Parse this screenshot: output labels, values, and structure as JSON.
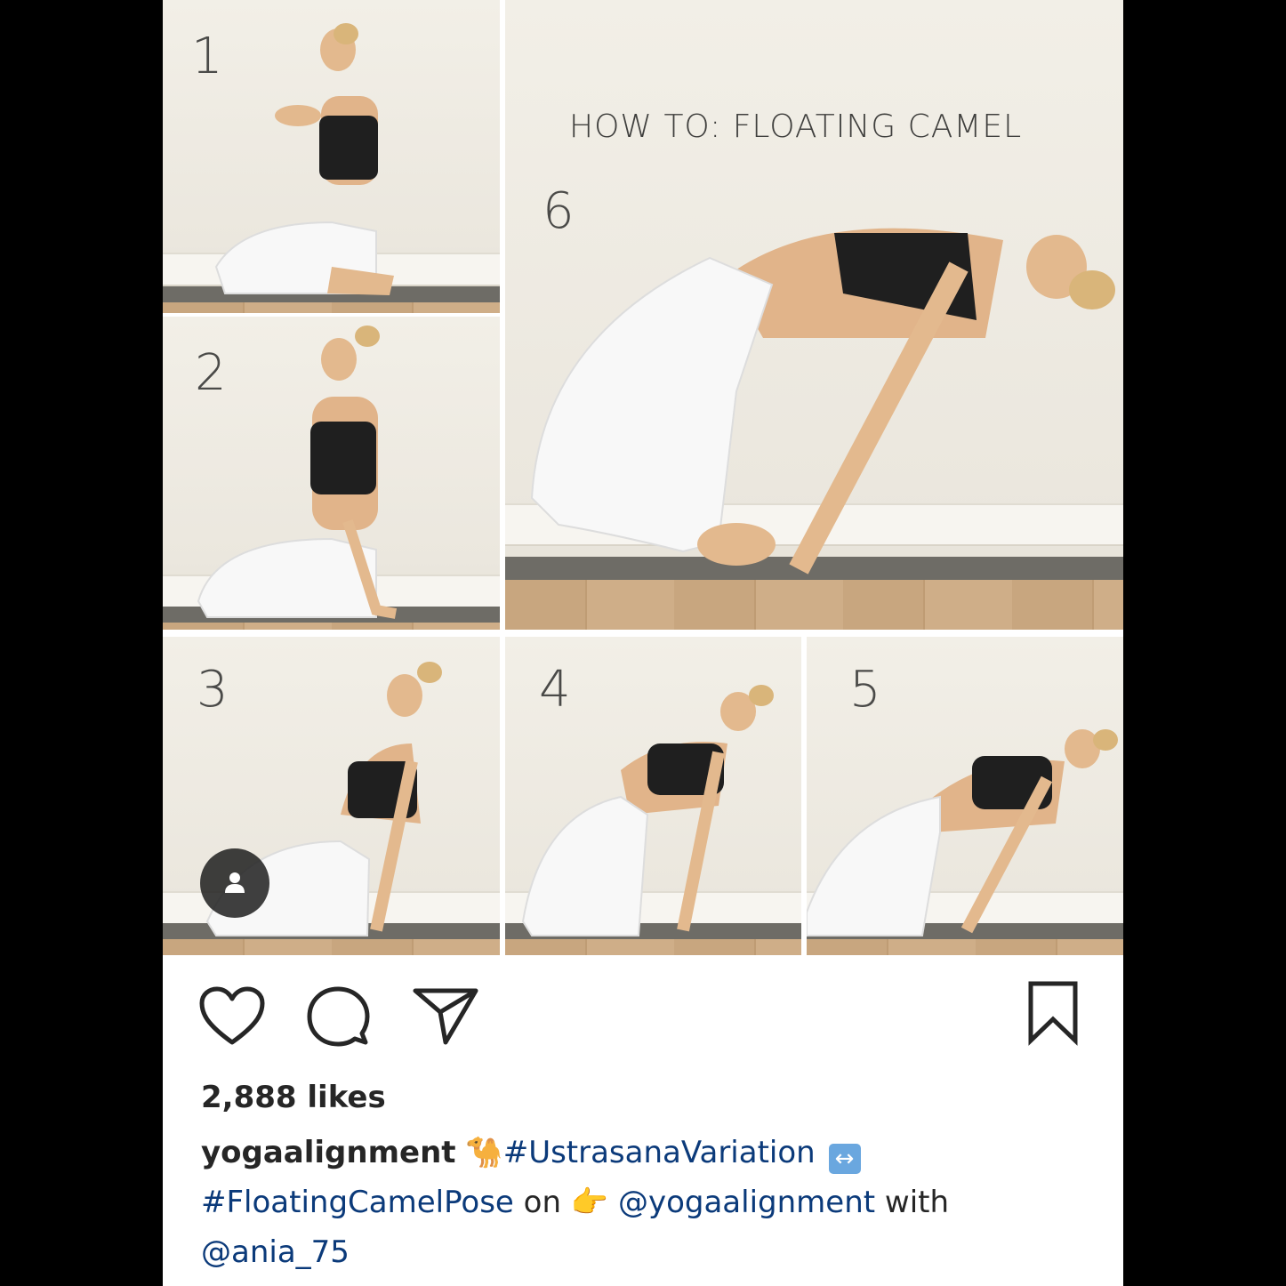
{
  "post": {
    "collage": {
      "title": "HOW TO: FLOATING CAMEL",
      "steps": [
        "1",
        "2",
        "3",
        "4",
        "5",
        "6"
      ]
    },
    "actions": {
      "like_icon": "heart-outline-icon",
      "comment_icon": "comment-bubble-icon",
      "share_icon": "paper-plane-icon",
      "save_icon": "bookmark-outline-icon"
    },
    "likes": "2,888 likes",
    "caption": {
      "username": "yogaalignment",
      "emoji_camel": "🐪",
      "hashtag1": "#UstrasanaVariation",
      "emoji_arrows": "↔️",
      "hashtag2": "#FloatingCamelPose",
      "word_on": "on",
      "emoji_point": "👉",
      "mention1": "@yogaalignment",
      "word_with": "with",
      "mention2": "@ania_75"
    },
    "colors": {
      "text": "#262626",
      "link": "#0b3a7a",
      "background": "#ffffff",
      "frame": "#000000"
    }
  }
}
